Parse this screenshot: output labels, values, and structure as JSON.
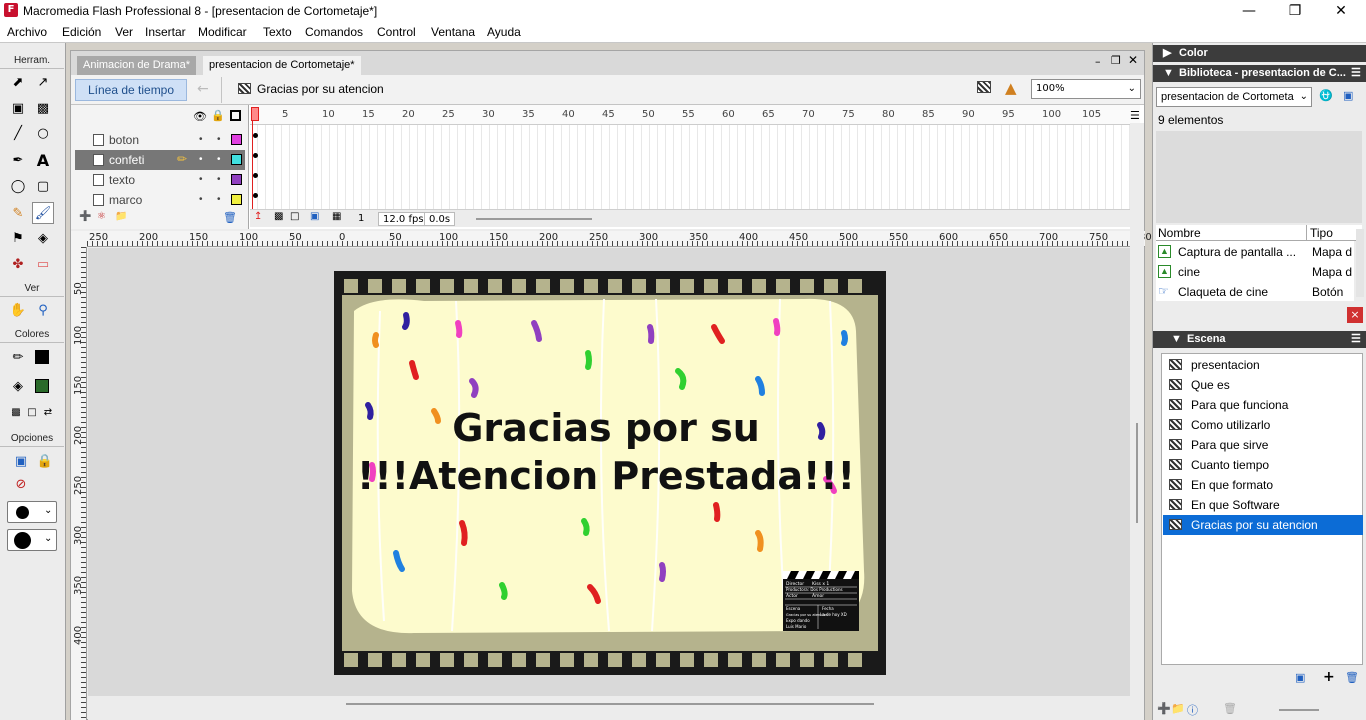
{
  "window": {
    "title": "Macromedia Flash Professional 8 - [presentacion de Cortometaje*]",
    "app_icon": "F"
  },
  "menu": [
    "Archivo",
    "Edición",
    "Ver",
    "Insertar",
    "Modificar",
    "Texto",
    "Comandos",
    "Control",
    "Ventana",
    "Ayuda"
  ],
  "tools": {
    "header": "Herram.",
    "view_header": "Ver",
    "colors_header": "Colores",
    "options_header": "Opciones"
  },
  "tabs": [
    "Animacion de Drama*",
    "presentacion de Cortometaje*"
  ],
  "editbar": {
    "timeline_button": "Línea de tiempo",
    "scene_name": "Gracias por su atencion",
    "zoom": "100%"
  },
  "timeline": {
    "layers": [
      {
        "name": "boton",
        "color": "#e040e0"
      },
      {
        "name": "confeti",
        "color": "#40e0e0"
      },
      {
        "name": "texto",
        "color": "#9040c0"
      },
      {
        "name": "marco",
        "color": "#f0f040"
      }
    ],
    "frame_numbers": [
      "1",
      "5",
      "10",
      "15",
      "20",
      "25",
      "30",
      "35",
      "40",
      "45",
      "50",
      "55",
      "60",
      "65",
      "70",
      "75",
      "80",
      "85",
      "90",
      "95",
      "100",
      "105"
    ],
    "current_frame": "1",
    "fps": "12.0 fps",
    "elapsed": "0.0s"
  },
  "rulers": {
    "h": [
      "250",
      "200",
      "150",
      "100",
      "50",
      "0",
      "50",
      "100",
      "150",
      "200",
      "250",
      "300",
      "350",
      "400",
      "450",
      "500",
      "550",
      "600",
      "650",
      "700",
      "750",
      "80"
    ],
    "v": [
      "50",
      "100",
      "150",
      "200",
      "250",
      "300",
      "350",
      "400"
    ]
  },
  "stage": {
    "line1": "Gracias por su",
    "line2": "!!!Atencion Prestada!!!",
    "clap": {
      "director_label": "Director",
      "director_value": "Kiss x 1",
      "productora": "Productora: Dos Productions",
      "actor_label": "Actor",
      "actor_value": "Amor",
      "escena_label": "Escena",
      "fecha_label": "Fecha",
      "escena_value": "Gracias por su atencion",
      "fecha_value": "La de hoy XD",
      "row3": "Expo dando",
      "row4": "Luis Mario"
    }
  },
  "panels": {
    "color_title": "Color",
    "library_title": "Biblioteca - presentacion de C...",
    "library_select": "presentacion de Cortometa",
    "library_count": "9 elementos",
    "library_cols": [
      "Nombre",
      "Tipo"
    ],
    "library_items": [
      {
        "name": "Captura de pantalla ...",
        "type": "Mapa d"
      },
      {
        "name": "cine",
        "type": "Mapa d"
      },
      {
        "name": "Claqueta de cine",
        "type": "Botón"
      }
    ],
    "scene_title": "Escena",
    "scenes": [
      "presentacion",
      "Que es",
      "Para que funciona",
      "Como utilizarlo",
      "Para que sirve",
      "Cuanto tiempo",
      "En que formato",
      "En que Software",
      "Gracias por su atencion"
    ]
  }
}
